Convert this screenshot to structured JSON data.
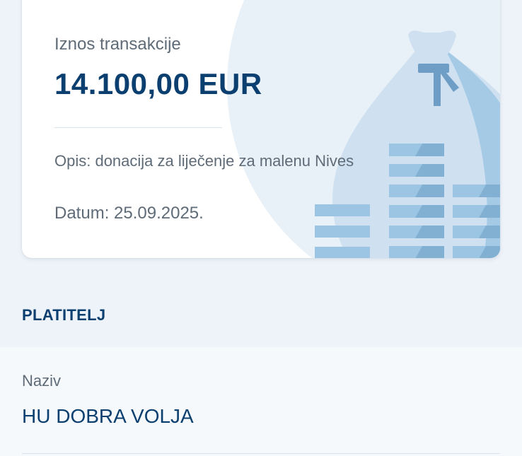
{
  "transaction": {
    "amount_label": "Iznos transakcije",
    "amount_value": "14.100,00 EUR",
    "description": "Opis: donacija za liječenje za malenu Nives",
    "date": "Datum: 25.09.2025."
  },
  "payer_section": {
    "title": "PLATITELJ",
    "name_label": "Naziv",
    "name_value": "HU DOBRA VOLJA"
  },
  "illustration": {
    "icon": "money-bag-with-coins-icon"
  },
  "colors": {
    "primary": "#0b3f6f",
    "text_secondary": "#5f6b77",
    "background": "#eef3f9",
    "illustration_light": "#cfe1f1",
    "illustration_mid": "#9cc5e3",
    "illustration_dark": "#6e9ec6"
  }
}
